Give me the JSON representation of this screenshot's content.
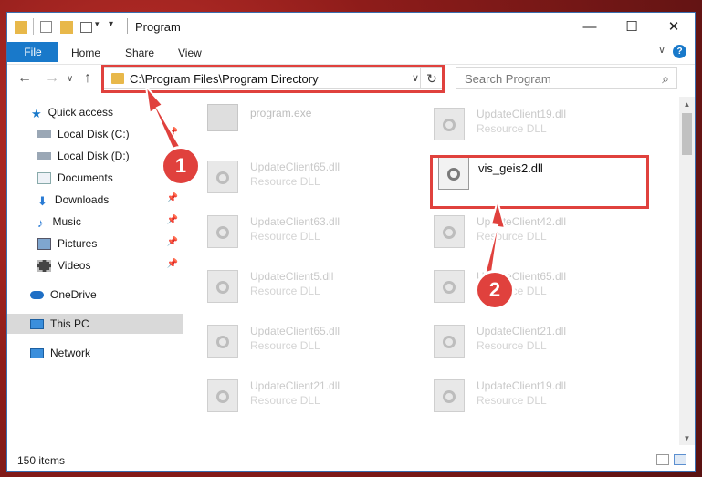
{
  "window": {
    "title": "Program",
    "min_glyph": "—",
    "max_glyph": "☐",
    "close_glyph": "✕"
  },
  "ribbon": {
    "file": "File",
    "home": "Home",
    "share": "Share",
    "view": "View",
    "help": "?",
    "collapse_glyph": "∨"
  },
  "nav": {
    "back": "←",
    "forward": "→",
    "recent": "∨",
    "up": "↑",
    "address": "C:\\Program Files\\Program Directory",
    "address_chev": "∨",
    "refresh": "↻",
    "search_placeholder": "Search Program",
    "search_glyph": "⌕"
  },
  "sidebar": {
    "quick_access": "Quick access",
    "local_c": "Local Disk (C:)",
    "local_d": "Local Disk (D:)",
    "documents": "Documents",
    "downloads": "Downloads",
    "music": "Music",
    "pictures": "Pictures",
    "videos": "Videos",
    "onedrive": "OneDrive",
    "this_pc": "This PC",
    "network": "Network"
  },
  "files": {
    "program_exe": "program.exe",
    "vis": "vis_geis2.dll",
    "uc19a": "UpdateClient19.dll",
    "uc65a": "UpdateClient65.dll",
    "uc63": "UpdateClient63.dll",
    "uc42": "UpdateClient42.dll",
    "uc5": "UpdateClient5.dll",
    "uc65b": "UpdateClient65.dll",
    "uc65c": "UpdateClient65.dll",
    "uc21a": "UpdateClient21.dll",
    "uc21b": "UpdateClient21.dll",
    "uc19b": "UpdateClient19.dll",
    "resource": "Resource DLL"
  },
  "status": {
    "count": "150 items"
  },
  "scroll": {
    "up": "▲",
    "down": "▼"
  },
  "annotations": {
    "one": "1",
    "two": "2"
  },
  "colors": {
    "accent": "#1979ca",
    "annotation_red": "#e0413d"
  }
}
